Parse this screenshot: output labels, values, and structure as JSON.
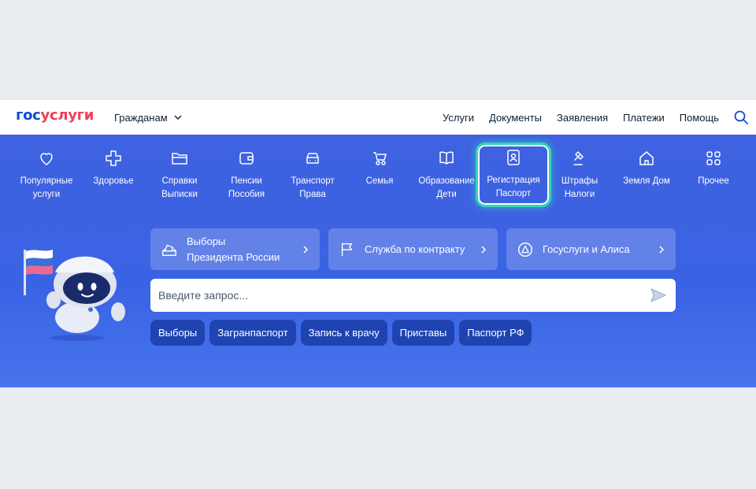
{
  "header": {
    "logo_part1": "гос",
    "logo_part2": "услуги",
    "role_label": "Гражданам",
    "nav": [
      "Услуги",
      "Документы",
      "Заявления",
      "Платежи",
      "Помощь"
    ]
  },
  "categories": [
    {
      "label": "Популярные\nуслуги",
      "icon": "heart-icon"
    },
    {
      "label": "Здоровье",
      "icon": "medical-cross-icon"
    },
    {
      "label": "Справки\nВыписки",
      "icon": "folder-icon"
    },
    {
      "label": "Пенсии\nПособия",
      "icon": "wallet-icon"
    },
    {
      "label": "Транспорт\nПрава",
      "icon": "car-icon"
    },
    {
      "label": "Семья",
      "icon": "stroller-icon"
    },
    {
      "label": "Образование\nДети",
      "icon": "book-icon"
    },
    {
      "label": "Регистрация\nПаспорт",
      "icon": "passport-icon"
    },
    {
      "label": "Штрафы\nНалоги",
      "icon": "gavel-icon"
    },
    {
      "label": "Земля Дом",
      "icon": "house-icon"
    },
    {
      "label": "Прочее",
      "icon": "grid-icon"
    }
  ],
  "active_category": "Регистрация Паспорт",
  "quick_links": [
    {
      "label": "Выборы\nПрезидента России",
      "icon": "ballot-box-icon"
    },
    {
      "label": "Служба по контракту",
      "icon": "flag-icon"
    },
    {
      "label": "Госуслуги и Алиса",
      "icon": "alice-icon"
    }
  ],
  "search": {
    "placeholder": "Введите запрос..."
  },
  "chips": [
    "Выборы",
    "Загранпаспорт",
    "Запись к врачу",
    "Приставы",
    "Паспорт РФ"
  ],
  "colors": {
    "brand_blue": "#0d4cd3",
    "brand_red": "#ee3f58",
    "hero_blue": "#3e62e0",
    "chip": "#1f44b2",
    "highlight": "#31d6bc"
  }
}
